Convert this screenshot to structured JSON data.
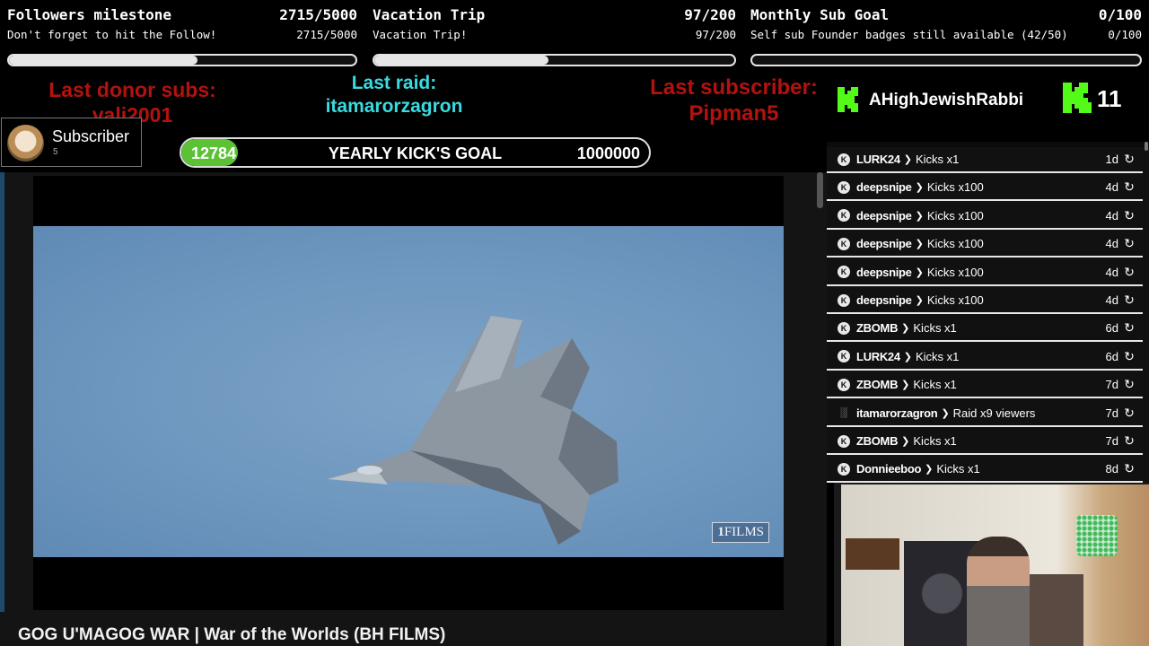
{
  "goals": [
    {
      "title": "Followers milestone",
      "value_text": "2715/5000",
      "subtitle": "Don't forget to hit the Follow!",
      "sub_value": "2715/5000",
      "progress": 0.543
    },
    {
      "title": "Vacation Trip",
      "value_text": "97/200",
      "subtitle": "Vacation Trip!",
      "sub_value": "97/200",
      "progress": 0.485
    },
    {
      "title": "Monthly Sub Goal",
      "value_text": "0/100",
      "subtitle": "Self sub Founder badges still available (42/50)",
      "sub_value": "0/100",
      "progress": 0.0
    }
  ],
  "alerts": {
    "last_donor_label": "Last donor subs:",
    "last_donor_name": "vali2001",
    "last_raid_label": "Last raid:",
    "last_raid_name": "itamarorzagron",
    "last_sub_label": "Last subscriber:",
    "last_sub_name": "Pipman5",
    "kick_user": "AHighJewishRabbi",
    "kick_count": "11"
  },
  "subscriber_card": {
    "title": "Subscriber",
    "count": "5"
  },
  "yearly_goal": {
    "current": "12784",
    "title": "YEARLY KICK'S GOAL",
    "target": "1000000",
    "progress": 0.012784
  },
  "video": {
    "watermark": "FILMS",
    "title": "GOG U'MAGOG WAR | War of the Worlds (BH FILMS)"
  },
  "events": [
    {
      "type": "kicks",
      "user": "LURK24",
      "action": "Kicks x1",
      "age": "1d"
    },
    {
      "type": "kicks",
      "user": "deepsnipe",
      "action": "Kicks x100",
      "age": "4d"
    },
    {
      "type": "kicks",
      "user": "deepsnipe",
      "action": "Kicks x100",
      "age": "4d"
    },
    {
      "type": "kicks",
      "user": "deepsnipe",
      "action": "Kicks x100",
      "age": "4d"
    },
    {
      "type": "kicks",
      "user": "deepsnipe",
      "action": "Kicks x100",
      "age": "4d"
    },
    {
      "type": "kicks",
      "user": "deepsnipe",
      "action": "Kicks x100",
      "age": "4d"
    },
    {
      "type": "kicks",
      "user": "ZBOMB",
      "action": "Kicks x1",
      "age": "6d"
    },
    {
      "type": "kicks",
      "user": "LURK24",
      "action": "Kicks x1",
      "age": "6d"
    },
    {
      "type": "kicks",
      "user": "ZBOMB",
      "action": "Kicks x1",
      "age": "7d"
    },
    {
      "type": "raid",
      "user": "itamarorzagron",
      "action": "Raid x9 viewers",
      "age": "7d"
    },
    {
      "type": "kicks",
      "user": "ZBOMB",
      "action": "Kicks x1",
      "age": "7d"
    },
    {
      "type": "kicks",
      "user": "Donnieeboo",
      "action": "Kicks x1",
      "age": "8d"
    }
  ],
  "colors": {
    "kick_green": "#53fc18",
    "goal_green": "#5bc236",
    "alert_red": "#b3120f",
    "alert_cyan": "#39dbe0"
  },
  "icons": {
    "event_kicks": "kick-coin-icon",
    "event_raid": "raid-icon",
    "event_replay": "replay-icon"
  }
}
